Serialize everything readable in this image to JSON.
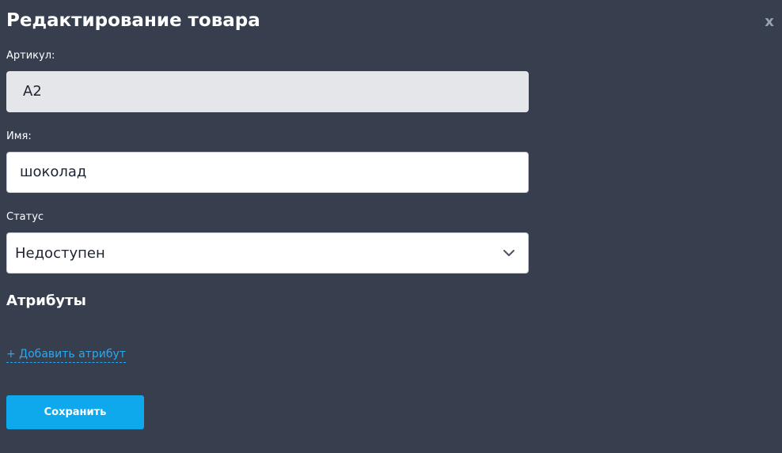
{
  "modal": {
    "title": "Редактирование товара",
    "close_label": "x"
  },
  "form": {
    "sku": {
      "label": "Артикул:",
      "value": "A2"
    },
    "name": {
      "label": "Имя:",
      "value": "шоколад"
    },
    "status": {
      "label": "Статус",
      "selected": "Недоступен"
    }
  },
  "attributes": {
    "title": "Атрибуты",
    "add_link": "+ Добавить атрибут"
  },
  "actions": {
    "save_label": "Сохранить"
  },
  "colors": {
    "background": "#373f4f",
    "accent": "#0ea9ec",
    "link": "#2aa8ef",
    "readonly_field": "#e5e6ea"
  },
  "icons": {
    "close": "close-icon",
    "select": "chevron-down-icon"
  }
}
